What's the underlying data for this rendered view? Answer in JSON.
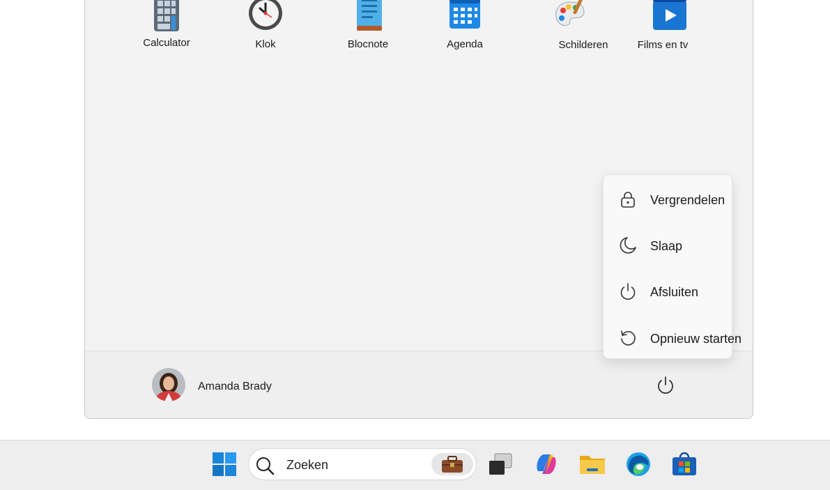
{
  "apps": [
    {
      "label": "Calculator",
      "icon": "calculator-icon"
    },
    {
      "label": "Klok",
      "icon": "clock-icon"
    },
    {
      "label": "Blocnote",
      "icon": "notepad-icon"
    },
    {
      "label": "Agenda",
      "icon": "calendar-icon"
    },
    {
      "label": "Schilderen",
      "icon": "paint-palette-icon"
    },
    {
      "label": "Films en tv",
      "icon": "films-tv-icon"
    }
  ],
  "user": {
    "name": "Amanda Brady"
  },
  "power_menu": {
    "items": [
      {
        "label": "Vergrendelen",
        "icon": "lock-icon"
      },
      {
        "label": "Slaap",
        "icon": "moon-icon"
      },
      {
        "label": "Afsluiten",
        "icon": "power-icon"
      },
      {
        "label": "Opnieuw starten",
        "icon": "restart-icon"
      }
    ]
  },
  "taskbar": {
    "search_placeholder": "Zoeken",
    "icons": [
      "windows-start-icon",
      "search-icon",
      "briefcase-widget-icon",
      "task-view-icon",
      "copilot-icon",
      "file-explorer-icon",
      "edge-icon",
      "store-icon"
    ]
  },
  "colors": {
    "menu_bg": "#f3f3f3",
    "accent_blue": "#0067c0",
    "taskbar_bg": "#eeeeee"
  }
}
